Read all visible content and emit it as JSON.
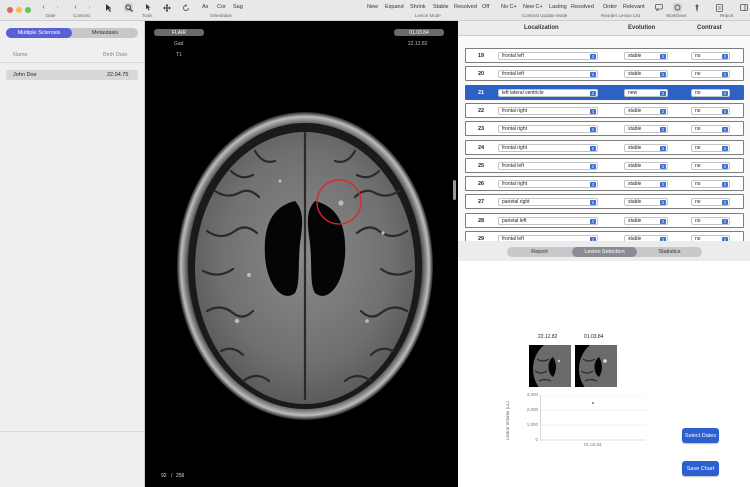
{
  "toolbar": {
    "date_caption": "Date",
    "contrast_caption": "Contrast",
    "tools_caption": "Tools",
    "orientation_caption": "Orientation",
    "orient_ax": "Ax",
    "orient_cor": "Cor",
    "orient_sag": "Sag",
    "lesion_mode_caption": "Lesion Mode",
    "lesion_new": "New",
    "lesion_expand": "Expand",
    "lesion_shrink": "Shrink",
    "lesion_stable": "Stable",
    "lesion_resolved": "Resolved",
    "lesion_off": "Off",
    "contrast_update_caption": "Contrast Update Mode",
    "cu_noc": "No C+",
    "cu_newc": "New C+",
    "cu_lasting": "Lasting",
    "cu_resolved": "Resolved",
    "reorder_caption": "Reorder Lesion List",
    "reorder_order": "Order",
    "reorder_relevant": "Relevant",
    "workflows_caption": "Workflows",
    "report_caption": "Report"
  },
  "sidebar": {
    "tabs": [
      "Multiple Sclerosis",
      "Metastasis"
    ],
    "active_tab": 0,
    "col_name": "Name",
    "col_birth": "Birth Date",
    "patients": [
      {
        "name": "John Doe",
        "birth": "22.04.75"
      }
    ]
  },
  "viewer": {
    "sequence": "FLAIR",
    "contrast": "Gad",
    "weighting": "T1",
    "date_current": "01.03.84",
    "date_prior": "22.12.82",
    "slice_current": "92",
    "slice_sep": "/",
    "slice_total": "256"
  },
  "lesion_table": {
    "headers": {
      "localization": "Localization",
      "evolution": "Evolution",
      "contrast": "Contrast"
    },
    "selected_row": "21",
    "rows": [
      {
        "num": "19",
        "loc": "frontal left",
        "evo": "stable",
        "con": "no"
      },
      {
        "num": "20",
        "loc": "frontal left",
        "evo": "stable",
        "con": "no"
      },
      {
        "num": "21",
        "loc": "left lateral ventricle",
        "evo": "new",
        "con": "no"
      },
      {
        "num": "22",
        "loc": "frontal right",
        "evo": "stable",
        "con": "no"
      },
      {
        "num": "23",
        "loc": "frontal right",
        "evo": "stable",
        "con": "no"
      },
      {
        "num": "24",
        "loc": "frontal right",
        "evo": "stable",
        "con": "no"
      },
      {
        "num": "25",
        "loc": "frontal left",
        "evo": "stable",
        "con": "no"
      },
      {
        "num": "26",
        "loc": "frontal right",
        "evo": "stable",
        "con": "no"
      },
      {
        "num": "27",
        "loc": "parietal right",
        "evo": "stable",
        "con": "no"
      },
      {
        "num": "28",
        "loc": "parietal left",
        "evo": "stable",
        "con": "no"
      },
      {
        "num": "29",
        "loc": "frontal left",
        "evo": "stable",
        "con": "no"
      }
    ]
  },
  "bottom_tabs": [
    "Report",
    "Lesion Selection",
    "Statistics"
  ],
  "active_bottom_tab": 1,
  "thumbnails": [
    {
      "date": "22.12.82"
    },
    {
      "date": "01.03.84"
    }
  ],
  "volume_chart": {
    "ylabel": "Lesion Volume (uL)",
    "yticks": [
      "3,000",
      "2,000",
      "1,000",
      "0"
    ],
    "xtick": "01.03.84"
  },
  "buttons": {
    "select_dates": "Select Dates",
    "save_chart": "Save Chart"
  },
  "colors": {
    "accent": "#2c62c5",
    "segment_active": "#5a60d4",
    "lesion_marker": "#e0242c"
  },
  "icons": [
    "chevron-left-icon",
    "chevron-right-icon",
    "arrow-cursor-icon",
    "magnifier-icon",
    "move-icon",
    "rotate-icon",
    "chat-icon",
    "circle-icon",
    "pin-icon",
    "document-icon",
    "sidebar-icon"
  ]
}
